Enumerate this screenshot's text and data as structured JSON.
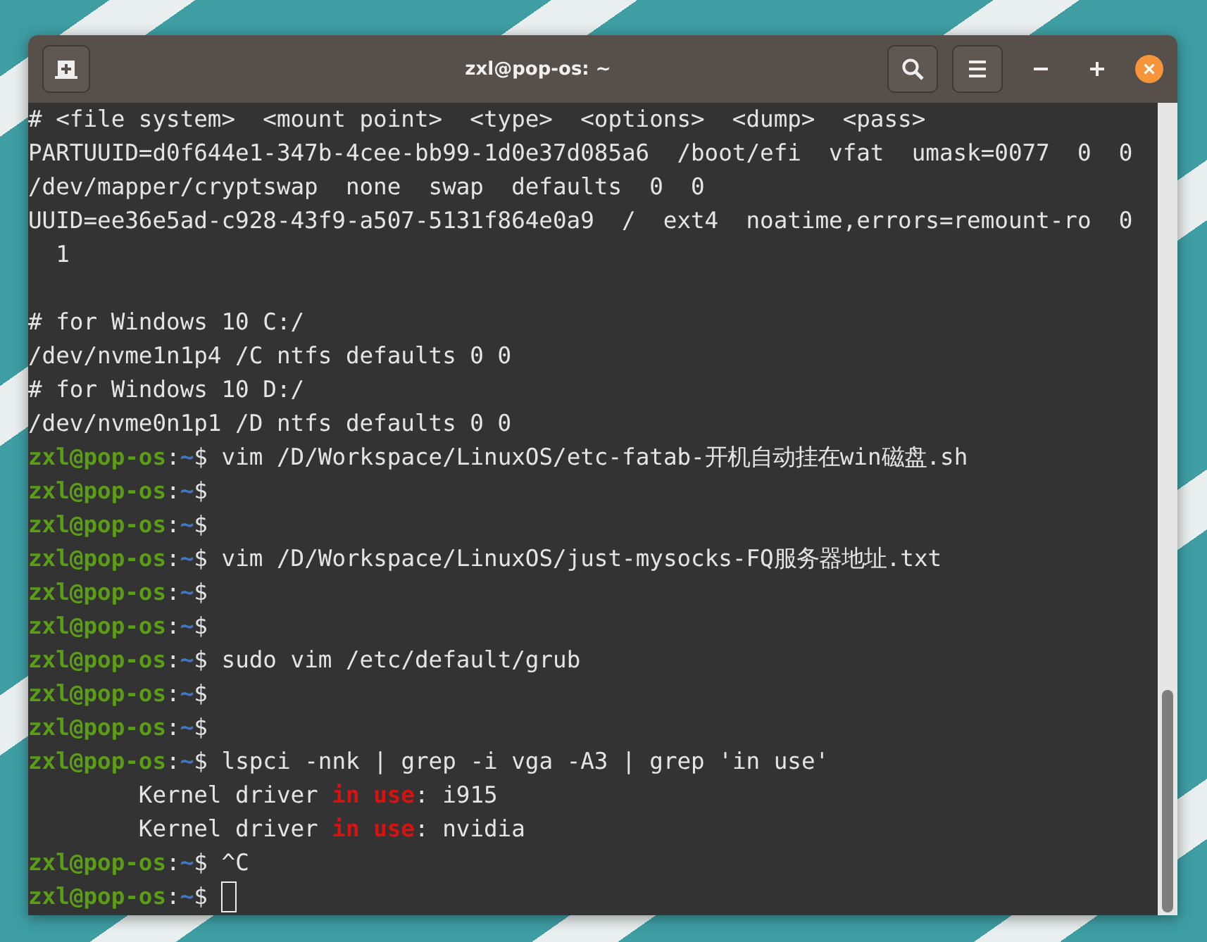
{
  "window": {
    "title": "zxl@pop-os: ~"
  },
  "terminal": {
    "lines": [
      {
        "kind": "plain",
        "text": "# <file system>  <mount point>  <type>  <options>  <dump>  <pass>"
      },
      {
        "kind": "plain",
        "text": "PARTUUID=d0f644e1-347b-4cee-bb99-1d0e37d085a6  /boot/efi  vfat  umask=0077  0  0"
      },
      {
        "kind": "plain",
        "text": "/dev/mapper/cryptswap  none  swap  defaults  0  0"
      },
      {
        "kind": "plain",
        "text": "UUID=ee36e5ad-c928-43f9-a507-5131f864e0a9  /  ext4  noatime,errors=remount-ro  0"
      },
      {
        "kind": "plain",
        "text": "  1"
      },
      {
        "kind": "blank"
      },
      {
        "kind": "plain",
        "text": "# for Windows 10 C:/"
      },
      {
        "kind": "plain",
        "text": "/dev/nvme1n1p4 /C ntfs defaults 0 0"
      },
      {
        "kind": "plain",
        "text": "# for Windows 10 D:/"
      },
      {
        "kind": "plain",
        "text": "/dev/nvme0n1p1 /D ntfs defaults 0 0"
      },
      {
        "kind": "prompt",
        "user": "zxl@pop-os",
        "sep": ":",
        "path": "~",
        "symbol": "$",
        "command": "vim /D/Workspace/LinuxOS/etc-fatab-开机自动挂在win磁盘.sh",
        "cursor": false
      },
      {
        "kind": "prompt",
        "user": "zxl@pop-os",
        "sep": ":",
        "path": "~",
        "symbol": "$",
        "cursor": false
      },
      {
        "kind": "prompt",
        "user": "zxl@pop-os",
        "sep": ":",
        "path": "~",
        "symbol": "$",
        "cursor": false
      },
      {
        "kind": "prompt",
        "user": "zxl@pop-os",
        "sep": ":",
        "path": "~",
        "symbol": "$",
        "command": "vim /D/Workspace/LinuxOS/just-mysocks-FQ服务器地址.txt",
        "cursor": false
      },
      {
        "kind": "prompt",
        "user": "zxl@pop-os",
        "sep": ":",
        "path": "~",
        "symbol": "$",
        "cursor": false
      },
      {
        "kind": "prompt",
        "user": "zxl@pop-os",
        "sep": ":",
        "path": "~",
        "symbol": "$",
        "cursor": false
      },
      {
        "kind": "prompt",
        "user": "zxl@pop-os",
        "sep": ":",
        "path": "~",
        "symbol": "$",
        "command": "sudo vim /etc/default/grub",
        "cursor": false
      },
      {
        "kind": "prompt",
        "user": "zxl@pop-os",
        "sep": ":",
        "path": "~",
        "symbol": "$",
        "cursor": false
      },
      {
        "kind": "prompt",
        "user": "zxl@pop-os",
        "sep": ":",
        "path": "~",
        "symbol": "$",
        "cursor": false
      },
      {
        "kind": "prompt",
        "user": "zxl@pop-os",
        "sep": ":",
        "path": "~",
        "symbol": "$",
        "command": "lspci -nnk | grep -i vga -A3 | grep 'in use'",
        "cursor": false
      },
      {
        "kind": "match",
        "before": "        Kernel driver ",
        "match": "in use",
        "after": ": i915"
      },
      {
        "kind": "match",
        "before": "        Kernel driver ",
        "match": "in use",
        "after": ": nvidia"
      },
      {
        "kind": "prompt",
        "user": "zxl@pop-os",
        "sep": ":",
        "path": "~",
        "symbol": "$",
        "command": "^C",
        "cursor": false
      },
      {
        "kind": "prompt",
        "user": "zxl@pop-os",
        "sep": ":",
        "path": "~",
        "symbol": "$",
        "cursor": true
      }
    ]
  }
}
